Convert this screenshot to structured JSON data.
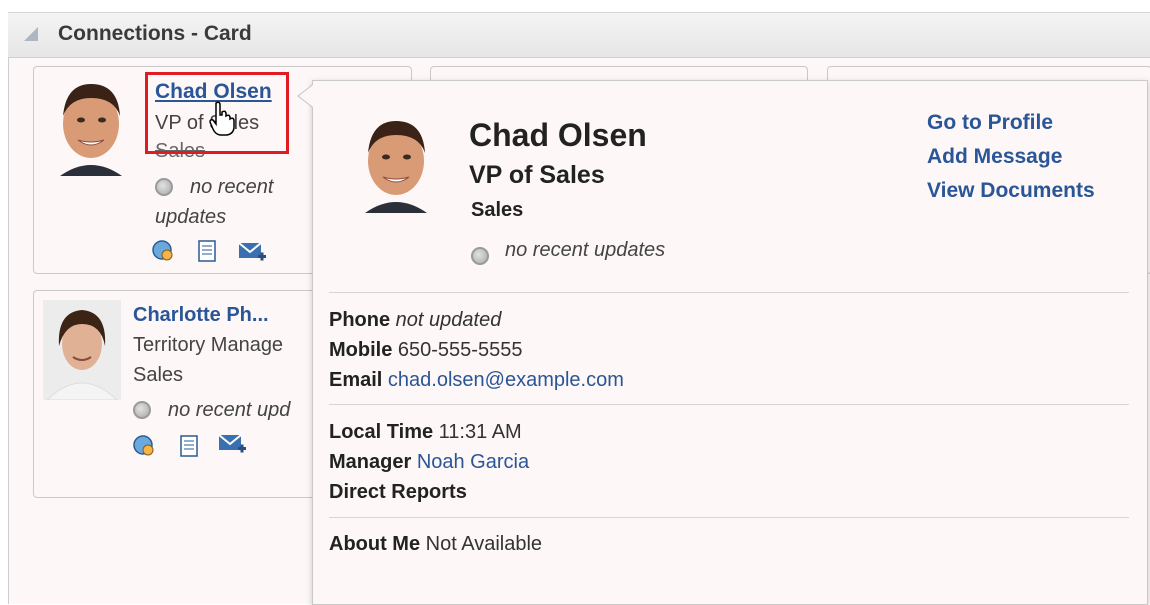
{
  "panel": {
    "title": "Connections - Card"
  },
  "cards": [
    {
      "name": "Chad Olsen",
      "title": "VP of Sales",
      "department": "Sales",
      "status_line1": "no recent",
      "status_line2": "updates"
    },
    {
      "name": "Charlotte Ph...",
      "title": "Territory Manage",
      "department": "Sales",
      "status": "no recent upd"
    }
  ],
  "popup": {
    "name": "Chad Olsen",
    "title": "VP of Sales",
    "department": "Sales",
    "status": "no recent updates",
    "actions": {
      "profile": "Go to Profile",
      "message": "Add Message",
      "documents": "View Documents"
    },
    "phone_label": "Phone",
    "phone_value": "not updated",
    "mobile_label": "Mobile",
    "mobile_value": "650-555-5555",
    "email_label": "Email",
    "email_value": "chad.olsen@example.com",
    "localtime_label": "Local Time",
    "localtime_value": "11:31 AM",
    "manager_label": "Manager",
    "manager_value": "Noah Garcia",
    "reports_label": "Direct Reports",
    "about_label": "About Me",
    "about_value": "Not Available"
  },
  "colors": {
    "link": "#2a5697",
    "highlight": "#e11b22",
    "background": "#fdf7f7"
  },
  "icons": [
    "collapse-triangle-icon",
    "status-icon",
    "globe-people-icon",
    "document-icon",
    "mail-add-icon",
    "hand-pointer-icon"
  ]
}
